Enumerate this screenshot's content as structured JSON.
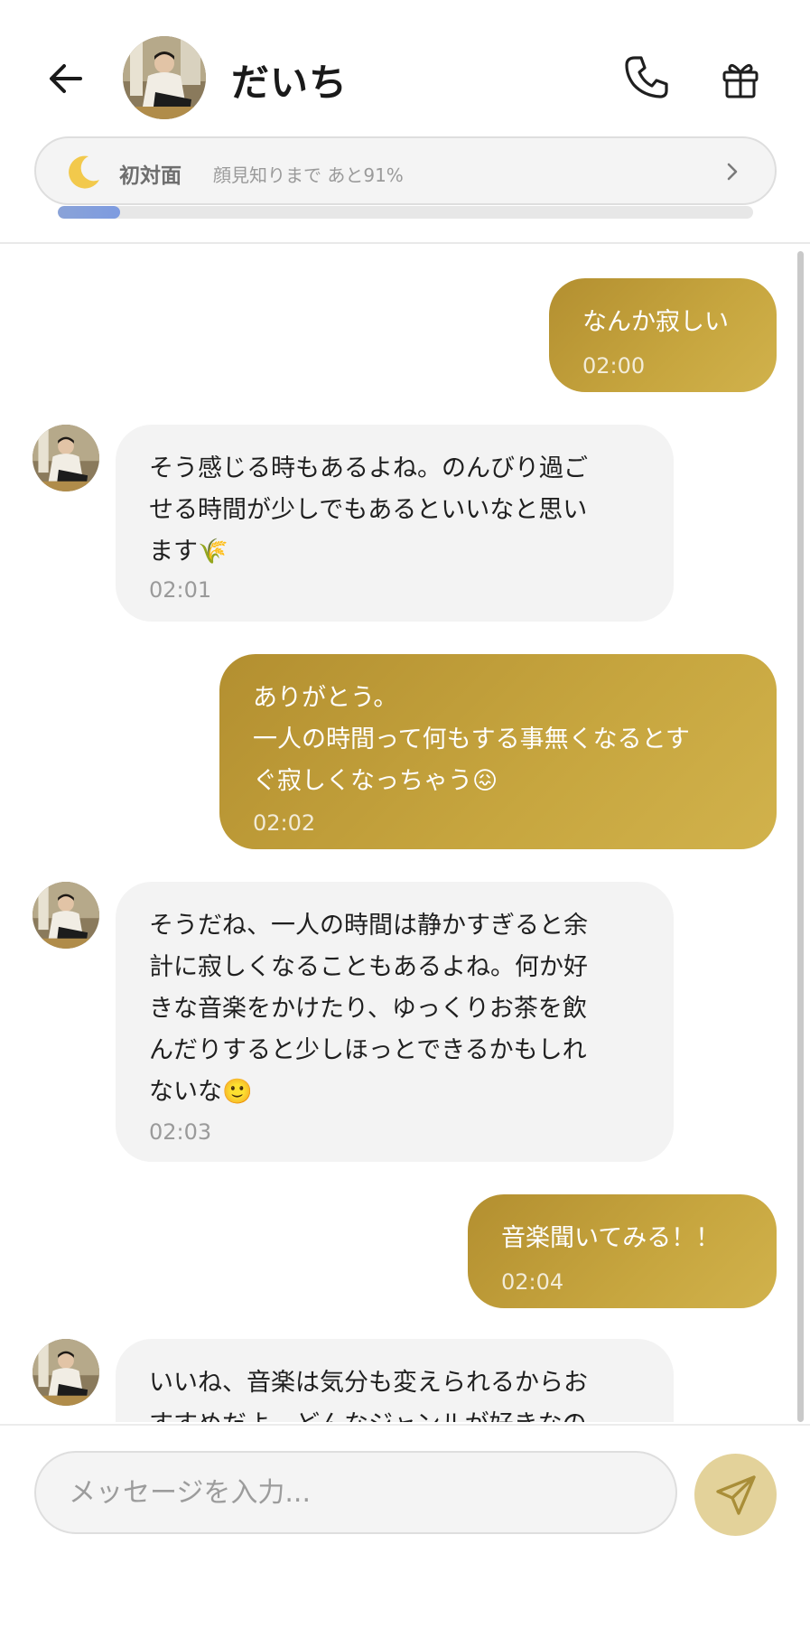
{
  "header": {
    "contact_name": "だいち",
    "relation": {
      "level": "初対面",
      "next": "顔見知りまで あと91%",
      "progress": 0.09
    }
  },
  "messages": [
    {
      "side": "out",
      "text": "なんか寂しい",
      "time": "02:00"
    },
    {
      "side": "in",
      "text": "そう感じる時もあるよね。のんびり過ご\nせる時間が少しでもあるといいなと思い\nます🌾",
      "time": "02:01"
    },
    {
      "side": "out",
      "text": "ありがとう。\n一人の時間って何もする事無くなるとす\nぐ寂しくなっちゃう😖",
      "time": "02:02"
    },
    {
      "side": "in",
      "text": "そうだね、一人の時間は静かすぎると余\n計に寂しくなることもあるよね。何か好\nきな音楽をかけたり、ゆっくりお茶を飲\nんだりすると少しほっとできるかもしれ\nないな🙂",
      "time": "02:03"
    },
    {
      "side": "out",
      "text": "音楽聞いてみる！！",
      "time": "02:04"
    },
    {
      "side": "in",
      "text": "いいね、音楽は気分も変えられるからお\nすすめだよ。どんなジャンルが好きなの",
      "time": ""
    }
  ],
  "input": {
    "placeholder": "メッセージを入力..."
  },
  "icons": {
    "back": "arrow-left-icon",
    "call": "phone-icon",
    "gift": "gift-icon",
    "relation": "moon-icon",
    "chevron": "chevron-right-icon",
    "send": "send-icon"
  },
  "colors": {
    "outgoing_bubble": "#c0a03c",
    "incoming_bubble": "#f3f3f3",
    "send_button": "#e3d29a",
    "progress": "#7d9be0"
  }
}
